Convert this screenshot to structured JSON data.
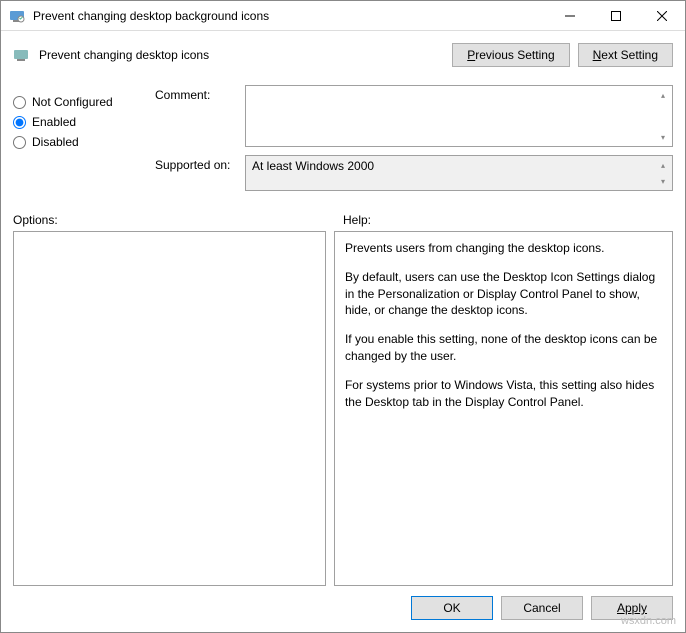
{
  "window": {
    "title": "Prevent changing desktop background icons"
  },
  "subtitle": "Prevent changing desktop icons",
  "nav": {
    "previous_pre": "P",
    "previous_mid": "revious Setting",
    "next_pre": "N",
    "next_mid": "ext Setting"
  },
  "radios": {
    "not_configured": "Not Configured",
    "enabled": "Enabled",
    "disabled": "Disabled",
    "selected": "enabled"
  },
  "fields": {
    "comment_label": "Comment:",
    "comment_value": "",
    "supported_label": "Supported on:",
    "supported_value": "At least Windows 2000"
  },
  "panels": {
    "options_label": "Options:",
    "help_label": "Help:",
    "options_content": "",
    "help_paragraphs": [
      "Prevents users from changing the desktop icons.",
      "By default, users can use the Desktop Icon Settings dialog in the Personalization or Display Control Panel to show, hide, or change the desktop icons.",
      "If you enable this setting, none of the desktop icons can be changed by the user.",
      "For systems prior to Windows Vista, this setting also hides the Desktop tab in the Display Control Panel."
    ]
  },
  "footer": {
    "ok": "OK",
    "cancel": "Cancel",
    "apply": "Apply"
  },
  "watermark": "wsxdn.com"
}
